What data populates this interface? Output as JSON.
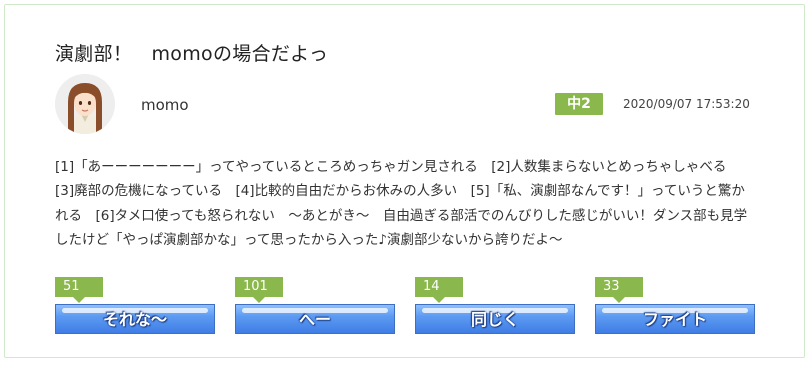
{
  "post": {
    "title": "演劇部！　momoの場合だよっ",
    "username": "momo",
    "grade": "中2",
    "timestamp": "2020/09/07 17:53:20",
    "body": "[1]「あーーーーーーー」ってやっているところめっちゃガン見される　[2]人数集まらないとめっちゃしゃべる　[3]廃部の危機になっている　[4]比較的自由だからお休みの人多い　[5]「私、演劇部なんです！」っていうと驚かれる　[6]タメ口使っても怒られない　〜あとがき〜　自由過ぎる部活でのんびりした感じがいい！ダンス部も見学したけど「やっぱ演劇部かな」って思ったから入った♪演劇部少ないから誇りだよ〜"
  },
  "reactions": [
    {
      "label": "それな〜",
      "count": "51"
    },
    {
      "label": "へー",
      "count": "101"
    },
    {
      "label": "同じく",
      "count": "14"
    },
    {
      "label": "ファイト",
      "count": "33"
    }
  ],
  "colors": {
    "badge_green": "#8bb84d",
    "button_blue": "#4d8cee",
    "card_border": "#cfe9c9"
  },
  "icons": {
    "avatar": "girl-avatar-icon"
  }
}
